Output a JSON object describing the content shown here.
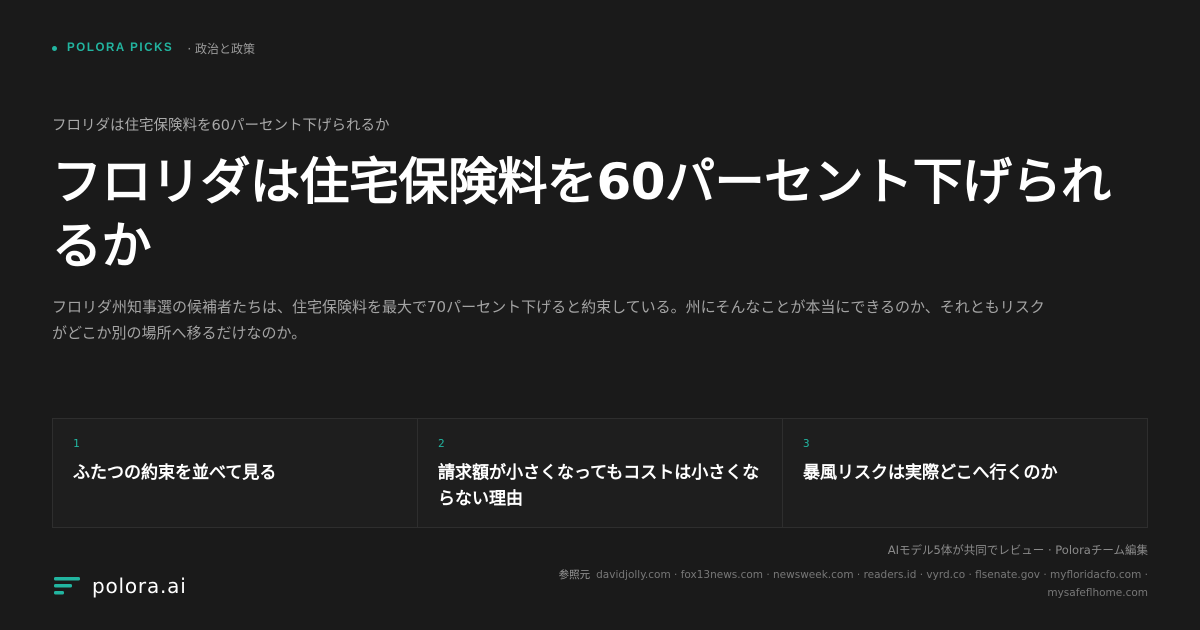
{
  "header": {
    "brand": "POLORA PICKS",
    "section": "· 政治と政策"
  },
  "article": {
    "kicker": "フロリダは住宅保険料を60パーセント下げられるか",
    "headline": "フロリダは住宅保険料を60パーセント下げられるか",
    "lede": "フロリダ州知事選の候補者たちは、住宅保険料を最大で70パーセント下げると約束している。州にそんなことが本当にできるのか、それともリスクがどこか別の場所へ移るだけなのか。"
  },
  "cards": [
    {
      "num": "1",
      "title": "ふたつの約束を並べて見る"
    },
    {
      "num": "2",
      "title": "請求額が小さくなってもコストは小さくならない理由"
    },
    {
      "num": "3",
      "title": "暴風リスクは実際どこへ行くのか"
    }
  ],
  "footer": {
    "logo_text": "polora.ai",
    "review_line": "AIモデル5体が共同でレビュー · Poloraチーム編集",
    "sources_label": "参照元",
    "sources": "davidjolly.com · fox13news.com · newsweek.com · readers.id · vyrd.co · flsenate.gov · myfloridacfo.com · mysafeflhome.com"
  },
  "colors": {
    "accent": "#22b5a0",
    "background": "#1a1a1a",
    "card_background": "#1e1e1e",
    "text_primary": "#ffffff",
    "text_muted": "#a3a3a3"
  },
  "icons": {
    "logo": "polora-logo-icon",
    "brand_marker": "dot-icon"
  }
}
